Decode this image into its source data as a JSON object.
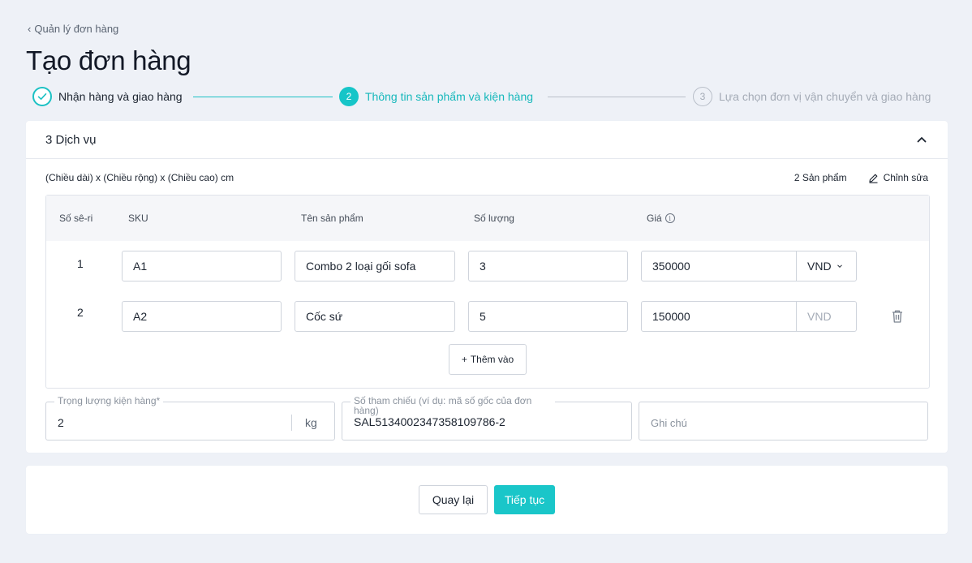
{
  "breadcrumb": {
    "label": "Quản lý đơn hàng"
  },
  "page": {
    "title": "Tạo đơn hàng"
  },
  "stepper": {
    "steps": [
      {
        "number": "1",
        "label": "Nhận hàng và giao hàng",
        "state": "done"
      },
      {
        "number": "2",
        "label": "Thông tin sản phẩm và kiện hàng",
        "state": "active"
      },
      {
        "number": "3",
        "label": "Lựa chọn đơn vị vận chuyển và giao hàng",
        "state": "pending"
      }
    ]
  },
  "package": {
    "title": "3 Dịch vụ",
    "dimensions": "(Chiều dài) x (Chiều rộng) x (Chiều cao) cm",
    "product_count": "2 Sản phẩm",
    "edit_label": "Chỉnh sửa",
    "columns": {
      "serial": "Số sê-ri",
      "sku": "SKU",
      "name": "Tên sản phẩm",
      "quantity": "Số lượng",
      "price": "Giá"
    },
    "rows": [
      {
        "serial": "1",
        "sku": "A1",
        "name": "Combo 2 loại gối sofa",
        "quantity": "3",
        "price": "350000",
        "currency": "VND"
      },
      {
        "serial": "2",
        "sku": "A2",
        "name": "Cốc sứ",
        "quantity": "5",
        "price": "150000",
        "currency": "VND"
      }
    ],
    "add_label": "Thêm vào",
    "weight": {
      "label": "Trọng lượng kiện hàng",
      "required_mark": "*",
      "value": "2",
      "unit": "kg"
    },
    "reference": {
      "label": "Số tham chiếu (ví dụ: mã số gốc của đơn hàng)",
      "value": "SAL5134002347358109786-2"
    },
    "note": {
      "placeholder": "Ghi chú"
    }
  },
  "footer": {
    "back_label": "Quay lại",
    "next_label": "Tiếp tục"
  },
  "colors": {
    "accent": "#16c5c8",
    "background": "#eef1f7",
    "pending": "#a4abb6"
  }
}
